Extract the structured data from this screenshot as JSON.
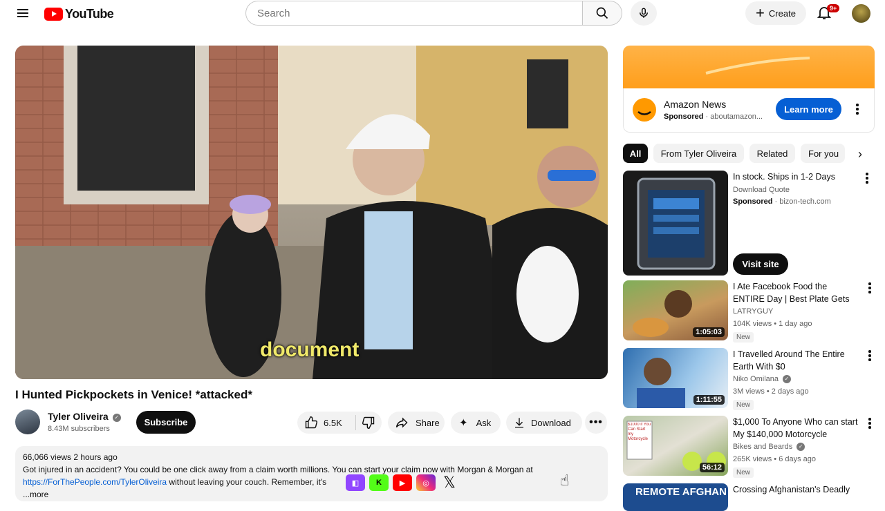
{
  "header": {
    "logo_text": "YouTube",
    "search_placeholder": "Search",
    "create_label": "Create",
    "notifications_badge": "9+"
  },
  "player": {
    "caption": "document"
  },
  "video": {
    "title": "I Hunted Pickpockets in Venice! *attacked*",
    "channel_name": "Tyler Oliveira",
    "subscribers": "8.43M subscribers",
    "subscribe_label": "Subscribe",
    "likes": "6.5K",
    "share_label": "Share",
    "ask_label": "Ask",
    "download_label": "Download"
  },
  "description": {
    "stats": "66,066 views  2 hours ago",
    "line1": "Got injured in an accident? You could be one click away from a claim worth millions. You can start your claim now with Morgan & Morgan at",
    "link": "https://ForThePeople.com/TylerOliveira",
    "line2_rest": " without leaving your couch. Remember, it's",
    "more": "...more"
  },
  "ad": {
    "title": "Amazon News",
    "sponsored": "Sponsored",
    "domain": "· aboutamazon...",
    "cta": "Learn more"
  },
  "chips": [
    "All",
    "From Tyler Oliveira",
    "Related",
    "For you"
  ],
  "sponsored_rec": {
    "title": "In stock. Ships in 1-2 Days",
    "subtitle": "Download Quote",
    "sponsored": "Sponsored",
    "domain": "· bizon-tech.com",
    "cta": "Visit site"
  },
  "recommendations": [
    {
      "title": "I Ate Facebook Food the ENTIRE Day | Best Plate Gets ...",
      "channel": "LATRYGUY",
      "views": "104K views • 1 day ago",
      "duration": "1:05:03",
      "badge": "New",
      "verified": false
    },
    {
      "title": "I Travelled Around The Entire Earth With $0",
      "channel": "Niko Omilana",
      "views": "3M views • 2 days ago",
      "duration": "1:11:55",
      "badge": "New",
      "verified": true
    },
    {
      "title": "$1,000 To Anyone Who can start My $140,000 Motorcycle",
      "channel": "Bikes and Beards",
      "views": "265K views • 6 days ago",
      "duration": "56:12",
      "badge": "New",
      "verified": true
    },
    {
      "title": "Crossing Afghanistan's Deadly",
      "thumb_text": "REMOTE AFGHAN"
    }
  ],
  "thumbnail_texts": {
    "motorcycle_sign": "$1000 if You Can Start my Motorcycle"
  },
  "colors": {
    "brand_red": "#ff0000",
    "subscribe_bg": "#0f0f0f",
    "link_blue": "#065fd4",
    "ad_orange": "#ff9e1b",
    "caption_yellow": "#f0e96a"
  },
  "icons": [
    "menu-icon",
    "search-icon",
    "mic-icon",
    "plus-icon",
    "bell-icon",
    "thumbs-up-icon",
    "thumbs-down-icon",
    "share-icon",
    "sparkle-icon",
    "download-icon",
    "more-icon",
    "chevron-right-icon"
  ]
}
